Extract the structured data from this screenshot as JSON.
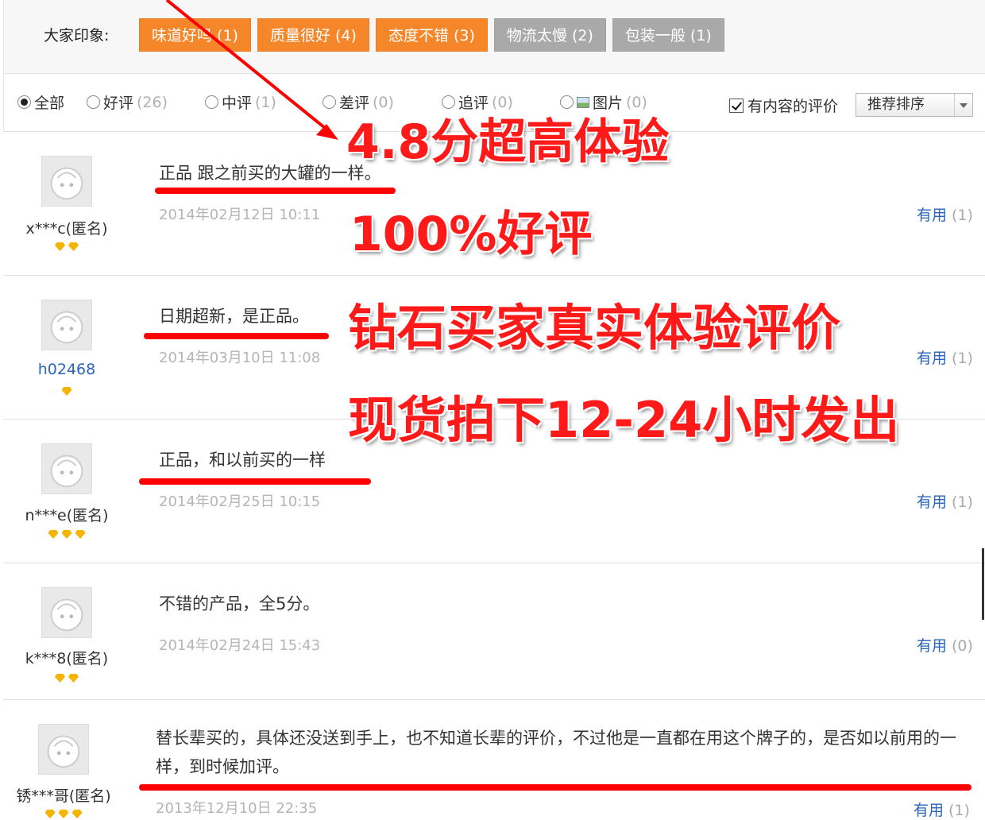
{
  "impressions": {
    "label": "大家印象:",
    "tags": [
      {
        "text": "味道好吗 (1)",
        "style": "hot"
      },
      {
        "text": "质量很好 (4)",
        "style": "hot"
      },
      {
        "text": "态度不错 (3)",
        "style": "hot"
      },
      {
        "text": "物流太慢 (2)",
        "style": "cold"
      },
      {
        "text": "包装一般 (1)",
        "style": "cold"
      }
    ]
  },
  "filters": {
    "all": {
      "label": "全部"
    },
    "good": {
      "label": "好评",
      "count": "(26)"
    },
    "medium": {
      "label": "中评",
      "count": "(1)"
    },
    "bad": {
      "label": "差评",
      "count": "(0)"
    },
    "followup": {
      "label": "追评",
      "count": "(0)"
    },
    "pictures": {
      "label": "图片",
      "count": "(0)"
    },
    "has_content": "有内容的评价",
    "sort": "推荐排序"
  },
  "reviews": [
    {
      "user": "x***c(匿名)",
      "text": "正品 跟之前买的大罐的一样。",
      "date": "2014年02月12日 10:11",
      "useful_label": "有用",
      "useful_count": "(1)",
      "diamonds": 2
    },
    {
      "user": "h02468",
      "text": "日期超新，是正品。",
      "date": "2014年03月10日 11:08",
      "useful_label": "有用",
      "useful_count": "(1)",
      "diamonds": 1
    },
    {
      "user": "n***e(匿名)",
      "text": "正品，和以前买的一样",
      "date": "2014年02月25日 10:15",
      "useful_label": "有用",
      "useful_count": "(1)",
      "diamonds": 3
    },
    {
      "user": "k***8(匿名)",
      "text": "不错的产品，全5分。",
      "date": "2014年02月24日 15:43",
      "useful_label": "有用",
      "useful_count": "(0)",
      "diamonds": 2
    },
    {
      "user": "锈***哥(匿名)",
      "text": "替长辈买的，具体还没送到手上，也不知道长辈的评价，不过他是一直都在用这个牌子的，是否如以前用的一样，到时候加评。",
      "date": "2013年12月10日 22:35",
      "useful_label": "有用",
      "useful_count": "(1)",
      "diamonds": 3
    }
  ],
  "promo": {
    "line1": "4.8分超高体验",
    "line2": "100%好评",
    "line3": "钻石买家真实体验评价",
    "line4": "现货拍下12-24小时发出"
  },
  "colors": {
    "tag_hot": "#f5862a",
    "tag_cold": "#a9a9a9",
    "annotation": "#ff1a1a",
    "link": "#2b64b8"
  }
}
